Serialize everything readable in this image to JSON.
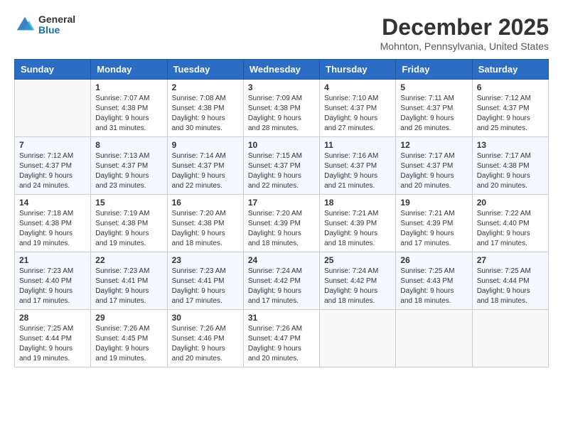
{
  "header": {
    "logo_general": "General",
    "logo_blue": "Blue",
    "month_title": "December 2025",
    "location": "Mohnton, Pennsylvania, United States"
  },
  "weekdays": [
    "Sunday",
    "Monday",
    "Tuesday",
    "Wednesday",
    "Thursday",
    "Friday",
    "Saturday"
  ],
  "weeks": [
    [
      {
        "day": "",
        "sunrise": "",
        "sunset": "",
        "daylight": ""
      },
      {
        "day": "1",
        "sunrise": "Sunrise: 7:07 AM",
        "sunset": "Sunset: 4:38 PM",
        "daylight": "Daylight: 9 hours and 31 minutes."
      },
      {
        "day": "2",
        "sunrise": "Sunrise: 7:08 AM",
        "sunset": "Sunset: 4:38 PM",
        "daylight": "Daylight: 9 hours and 30 minutes."
      },
      {
        "day": "3",
        "sunrise": "Sunrise: 7:09 AM",
        "sunset": "Sunset: 4:38 PM",
        "daylight": "Daylight: 9 hours and 28 minutes."
      },
      {
        "day": "4",
        "sunrise": "Sunrise: 7:10 AM",
        "sunset": "Sunset: 4:37 PM",
        "daylight": "Daylight: 9 hours and 27 minutes."
      },
      {
        "day": "5",
        "sunrise": "Sunrise: 7:11 AM",
        "sunset": "Sunset: 4:37 PM",
        "daylight": "Daylight: 9 hours and 26 minutes."
      },
      {
        "day": "6",
        "sunrise": "Sunrise: 7:12 AM",
        "sunset": "Sunset: 4:37 PM",
        "daylight": "Daylight: 9 hours and 25 minutes."
      }
    ],
    [
      {
        "day": "7",
        "sunrise": "Sunrise: 7:12 AM",
        "sunset": "Sunset: 4:37 PM",
        "daylight": "Daylight: 9 hours and 24 minutes."
      },
      {
        "day": "8",
        "sunrise": "Sunrise: 7:13 AM",
        "sunset": "Sunset: 4:37 PM",
        "daylight": "Daylight: 9 hours and 23 minutes."
      },
      {
        "day": "9",
        "sunrise": "Sunrise: 7:14 AM",
        "sunset": "Sunset: 4:37 PM",
        "daylight": "Daylight: 9 hours and 22 minutes."
      },
      {
        "day": "10",
        "sunrise": "Sunrise: 7:15 AM",
        "sunset": "Sunset: 4:37 PM",
        "daylight": "Daylight: 9 hours and 22 minutes."
      },
      {
        "day": "11",
        "sunrise": "Sunrise: 7:16 AM",
        "sunset": "Sunset: 4:37 PM",
        "daylight": "Daylight: 9 hours and 21 minutes."
      },
      {
        "day": "12",
        "sunrise": "Sunrise: 7:17 AM",
        "sunset": "Sunset: 4:37 PM",
        "daylight": "Daylight: 9 hours and 20 minutes."
      },
      {
        "day": "13",
        "sunrise": "Sunrise: 7:17 AM",
        "sunset": "Sunset: 4:38 PM",
        "daylight": "Daylight: 9 hours and 20 minutes."
      }
    ],
    [
      {
        "day": "14",
        "sunrise": "Sunrise: 7:18 AM",
        "sunset": "Sunset: 4:38 PM",
        "daylight": "Daylight: 9 hours and 19 minutes."
      },
      {
        "day": "15",
        "sunrise": "Sunrise: 7:19 AM",
        "sunset": "Sunset: 4:38 PM",
        "daylight": "Daylight: 9 hours and 19 minutes."
      },
      {
        "day": "16",
        "sunrise": "Sunrise: 7:20 AM",
        "sunset": "Sunset: 4:38 PM",
        "daylight": "Daylight: 9 hours and 18 minutes."
      },
      {
        "day": "17",
        "sunrise": "Sunrise: 7:20 AM",
        "sunset": "Sunset: 4:39 PM",
        "daylight": "Daylight: 9 hours and 18 minutes."
      },
      {
        "day": "18",
        "sunrise": "Sunrise: 7:21 AM",
        "sunset": "Sunset: 4:39 PM",
        "daylight": "Daylight: 9 hours and 18 minutes."
      },
      {
        "day": "19",
        "sunrise": "Sunrise: 7:21 AM",
        "sunset": "Sunset: 4:39 PM",
        "daylight": "Daylight: 9 hours and 17 minutes."
      },
      {
        "day": "20",
        "sunrise": "Sunrise: 7:22 AM",
        "sunset": "Sunset: 4:40 PM",
        "daylight": "Daylight: 9 hours and 17 minutes."
      }
    ],
    [
      {
        "day": "21",
        "sunrise": "Sunrise: 7:23 AM",
        "sunset": "Sunset: 4:40 PM",
        "daylight": "Daylight: 9 hours and 17 minutes."
      },
      {
        "day": "22",
        "sunrise": "Sunrise: 7:23 AM",
        "sunset": "Sunset: 4:41 PM",
        "daylight": "Daylight: 9 hours and 17 minutes."
      },
      {
        "day": "23",
        "sunrise": "Sunrise: 7:23 AM",
        "sunset": "Sunset: 4:41 PM",
        "daylight": "Daylight: 9 hours and 17 minutes."
      },
      {
        "day": "24",
        "sunrise": "Sunrise: 7:24 AM",
        "sunset": "Sunset: 4:42 PM",
        "daylight": "Daylight: 9 hours and 17 minutes."
      },
      {
        "day": "25",
        "sunrise": "Sunrise: 7:24 AM",
        "sunset": "Sunset: 4:42 PM",
        "daylight": "Daylight: 9 hours and 18 minutes."
      },
      {
        "day": "26",
        "sunrise": "Sunrise: 7:25 AM",
        "sunset": "Sunset: 4:43 PM",
        "daylight": "Daylight: 9 hours and 18 minutes."
      },
      {
        "day": "27",
        "sunrise": "Sunrise: 7:25 AM",
        "sunset": "Sunset: 4:44 PM",
        "daylight": "Daylight: 9 hours and 18 minutes."
      }
    ],
    [
      {
        "day": "28",
        "sunrise": "Sunrise: 7:25 AM",
        "sunset": "Sunset: 4:44 PM",
        "daylight": "Daylight: 9 hours and 19 minutes."
      },
      {
        "day": "29",
        "sunrise": "Sunrise: 7:26 AM",
        "sunset": "Sunset: 4:45 PM",
        "daylight": "Daylight: 9 hours and 19 minutes."
      },
      {
        "day": "30",
        "sunrise": "Sunrise: 7:26 AM",
        "sunset": "Sunset: 4:46 PM",
        "daylight": "Daylight: 9 hours and 20 minutes."
      },
      {
        "day": "31",
        "sunrise": "Sunrise: 7:26 AM",
        "sunset": "Sunset: 4:47 PM",
        "daylight": "Daylight: 9 hours and 20 minutes."
      },
      {
        "day": "",
        "sunrise": "",
        "sunset": "",
        "daylight": ""
      },
      {
        "day": "",
        "sunrise": "",
        "sunset": "",
        "daylight": ""
      },
      {
        "day": "",
        "sunrise": "",
        "sunset": "",
        "daylight": ""
      }
    ]
  ]
}
